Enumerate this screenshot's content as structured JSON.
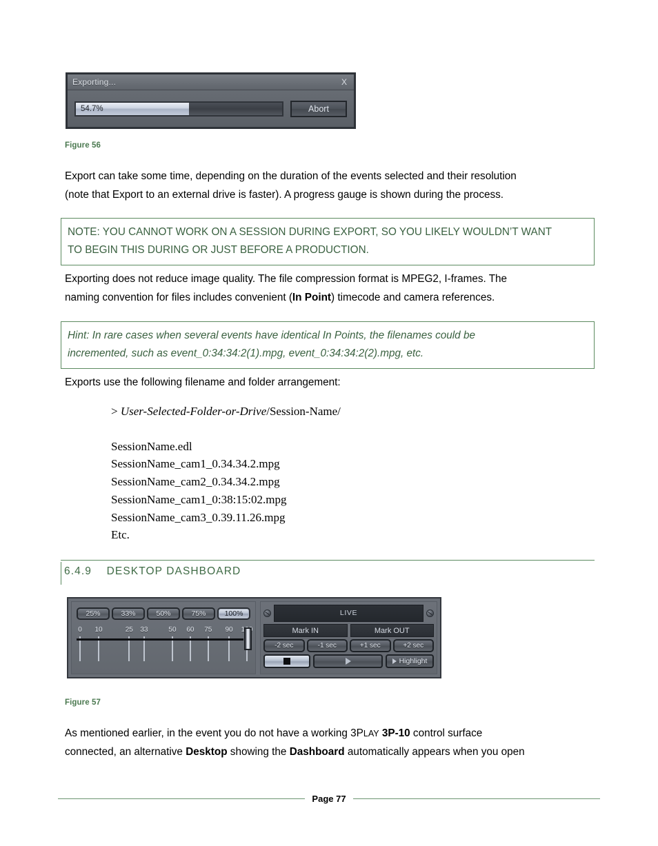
{
  "export_dialog": {
    "title": "Exporting...",
    "close_label": "X",
    "progress_percent": "54.7%",
    "progress_value": 54.7,
    "abort_label": "Abort"
  },
  "figures": {
    "fig56_caption": "Figure 56",
    "fig57_caption": "Figure 57"
  },
  "paragraphs": {
    "p1_line1": "Export can take some time, depending on the duration of the events selected and their resolution",
    "p1_line2": "(note that Export to an external drive is faster).  A progress gauge is shown during the process.",
    "p3_line1_a": "Exporting does not reduce image quality.  The file compression format is MPEG2, I-frames.  The",
    "p3_line2_a": "naming convention for files includes convenient (",
    "p3_line2_bold": "In Point",
    "p3_line2_b": ") timecode and camera references.",
    "p4": "Exports use the following filename and folder arrangement:",
    "p6_a": "As mentioned earlier, in the event you do not have a working 3P",
    "p6_smallcaps": "LAY",
    "p6_b": " ",
    "p6_bold1": "3P-10",
    "p6_c": " control surface",
    "p6_line2_a": "connected, an alternative ",
    "p6_bold2": "Desktop",
    "p6_line2_b": " showing the ",
    "p6_bold3": "Dashboard",
    "p6_line2_c": " automatically appears when you open"
  },
  "note_box": {
    "line1": "NOTE: YOU CANNOT WORK ON A SESSION DURING EXPORT, SO YOU LIKELY WOULDN’T WANT",
    "line2": "TO BEGIN THIS DURING OR JUST BEFORE A PRODUCTION."
  },
  "hint_box": {
    "line1": "Hint: In rare cases when several events have identical In Points, the filenames could be",
    "line2": "incremented, such as event_0:34:34:2(1).mpg, event_0:34:34:2(2).mpg, etc."
  },
  "path_block": {
    "prefix": "> ",
    "italic_part": "User-Selected-Folder-or-Drive",
    "rest": "/Session-Name/",
    "files": [
      "SessionName.edl",
      "SessionName_cam1_0.34.34.2.mpg",
      "SessionName_cam2_0.34.34.2.mpg",
      "SessionName_cam1_0:38:15:02.mpg",
      "SessionName_cam3_0.39.11.26.mpg",
      "Etc."
    ]
  },
  "section_heading": {
    "number": "6.4.9",
    "title": "DESKTOP DASHBOARD",
    "full": "6.4.9    DESKTOP DASHBOARD"
  },
  "dashboard": {
    "speed_buttons": [
      {
        "label": "25%",
        "active": false
      },
      {
        "label": "33%",
        "active": false
      },
      {
        "label": "50%",
        "active": false
      },
      {
        "label": "75%",
        "active": false
      },
      {
        "label": "100%",
        "active": true
      }
    ],
    "scale_labels": [
      "0",
      "10",
      "25",
      "33",
      "50",
      "60",
      "75",
      "90",
      "100"
    ],
    "scale_positions": [
      0,
      12.5,
      33,
      43,
      62,
      74,
      86,
      100,
      112
    ],
    "slider_value": "100",
    "live_label": "LIVE",
    "mark_in_label": "Mark IN",
    "mark_out_label": "Mark OUT",
    "sec_buttons": [
      "-2 sec",
      "-1 sec",
      "+1 sec",
      "+2 sec"
    ],
    "stop_label": "stop",
    "play_label": "play",
    "highlight_label": "Highlight"
  },
  "footer": {
    "page_label": "Page 77"
  },
  "colors": {
    "accent_green": "#4b7950",
    "box_border_green": "#5b8a5f",
    "heading_green": "#3f6b45",
    "note_text_green": "#3a6140",
    "panel_gray": "#6a6f77",
    "panel_dark": "#2c3036"
  }
}
